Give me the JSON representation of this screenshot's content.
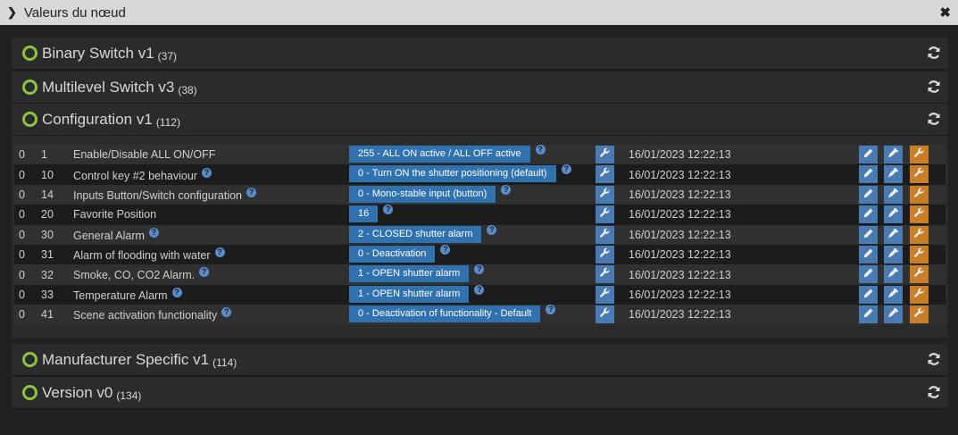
{
  "window": {
    "title": "Valeurs du nœud"
  },
  "panels": [
    {
      "name": "Binary Switch v1",
      "count": "(37)"
    },
    {
      "name": "Multilevel Switch v3",
      "count": "(38)"
    },
    {
      "name": "Configuration v1",
      "count": "(112)"
    },
    {
      "name": "Manufacturer Specific v1",
      "count": "(114)"
    },
    {
      "name": "Version v0",
      "count": "(134)"
    }
  ],
  "rows": [
    {
      "instance": "0",
      "index": "1",
      "label": "Enable/Disable ALL ON/OFF",
      "help_label": false,
      "value": "255 - ALL ON active / ALL OFF active",
      "time": "16/01/2023 12:22:13"
    },
    {
      "instance": "0",
      "index": "10",
      "label": "Control key #2 behaviour",
      "help_label": true,
      "value": "0 - Turn ON the shutter positioning (default)",
      "time": "16/01/2023 12:22:13"
    },
    {
      "instance": "0",
      "index": "14",
      "label": "Inputs Button/Switch configuration",
      "help_label": true,
      "value": "0 - Mono-stable input (button)",
      "time": "16/01/2023 12:22:13"
    },
    {
      "instance": "0",
      "index": "20",
      "label": "Favorite Position",
      "help_label": false,
      "value": "16",
      "time": "16/01/2023 12:22:13"
    },
    {
      "instance": "0",
      "index": "30",
      "label": "General Alarm",
      "help_label": true,
      "value": "2 - CLOSED shutter alarm",
      "time": "16/01/2023 12:22:13"
    },
    {
      "instance": "0",
      "index": "31",
      "label": "Alarm of flooding with water",
      "help_label": true,
      "value": "0 - Deactivation",
      "time": "16/01/2023 12:22:13"
    },
    {
      "instance": "0",
      "index": "32",
      "label": "Smoke, CO, CO2 Alarm.",
      "help_label": true,
      "value": "1 - OPEN shutter alarm",
      "time": "16/01/2023 12:22:13"
    },
    {
      "instance": "0",
      "index": "33",
      "label": "Temperature Alarm",
      "help_label": true,
      "value": "1 - OPEN shutter alarm",
      "time": "16/01/2023 12:22:13"
    },
    {
      "instance": "0",
      "index": "41",
      "label": "Scene activation functionality",
      "help_label": true,
      "value": "0 - Deactivation of functionality - Default",
      "time": "16/01/2023 12:22:13"
    }
  ],
  "help_glyph": "?",
  "colors": {
    "accent_green": "#8cc63f",
    "value_blue": "#2f72ad",
    "button_blue": "#4a7ab2",
    "button_orange": "#c97f25"
  }
}
